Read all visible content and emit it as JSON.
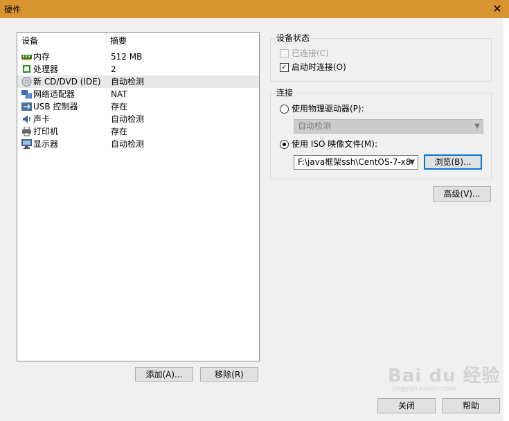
{
  "window": {
    "title": "硬件",
    "close_glyph": "✕"
  },
  "device_list": {
    "columns": {
      "device": "设备",
      "summary": "摘要"
    },
    "rows": [
      {
        "name": "内存",
        "summary": "512 MB",
        "icon": "memory-icon",
        "selected": false
      },
      {
        "name": "处理器",
        "summary": "2",
        "icon": "processor-icon",
        "selected": false
      },
      {
        "name": "新 CD/DVD (IDE)",
        "summary": "自动检测",
        "icon": "cd-dvd-icon",
        "selected": true
      },
      {
        "name": "网络适配器",
        "summary": "NAT",
        "icon": "network-adapter-icon",
        "selected": false
      },
      {
        "name": "USB 控制器",
        "summary": "存在",
        "icon": "usb-icon",
        "selected": false
      },
      {
        "name": "声卡",
        "summary": "自动检测",
        "icon": "sound-card-icon",
        "selected": false
      },
      {
        "name": "打印机",
        "summary": "存在",
        "icon": "printer-icon",
        "selected": false
      },
      {
        "name": "显示器",
        "summary": "自动检测",
        "icon": "display-icon",
        "selected": false
      }
    ]
  },
  "buttons": {
    "add": "添加(A)...",
    "remove": "移除(R)",
    "browse": "浏览(B)...",
    "advanced": "高级(V)...",
    "close": "关闭",
    "help": "帮助"
  },
  "device_status": {
    "title": "设备状态",
    "connected": {
      "label": "已连接(C)",
      "checked": false,
      "disabled": true
    },
    "connect_at_power_on": {
      "label": "启动时连接(O)",
      "checked": true,
      "disabled": false
    }
  },
  "connection": {
    "title": "连接",
    "physical_drive": {
      "label": "使用物理驱动器(P):",
      "selected": false
    },
    "physical_drive_value": "自动检测",
    "iso_image": {
      "label": "使用 ISO 映像文件(M):",
      "selected": true
    },
    "iso_path": "F:\\java框架ssh\\CentOS-7-x8"
  },
  "watermark": {
    "text": "Bai du 经验",
    "sub": "jingyan.baidu.com"
  },
  "colors": {
    "titlebar": "#d8952f",
    "focus": "#0078d7"
  }
}
